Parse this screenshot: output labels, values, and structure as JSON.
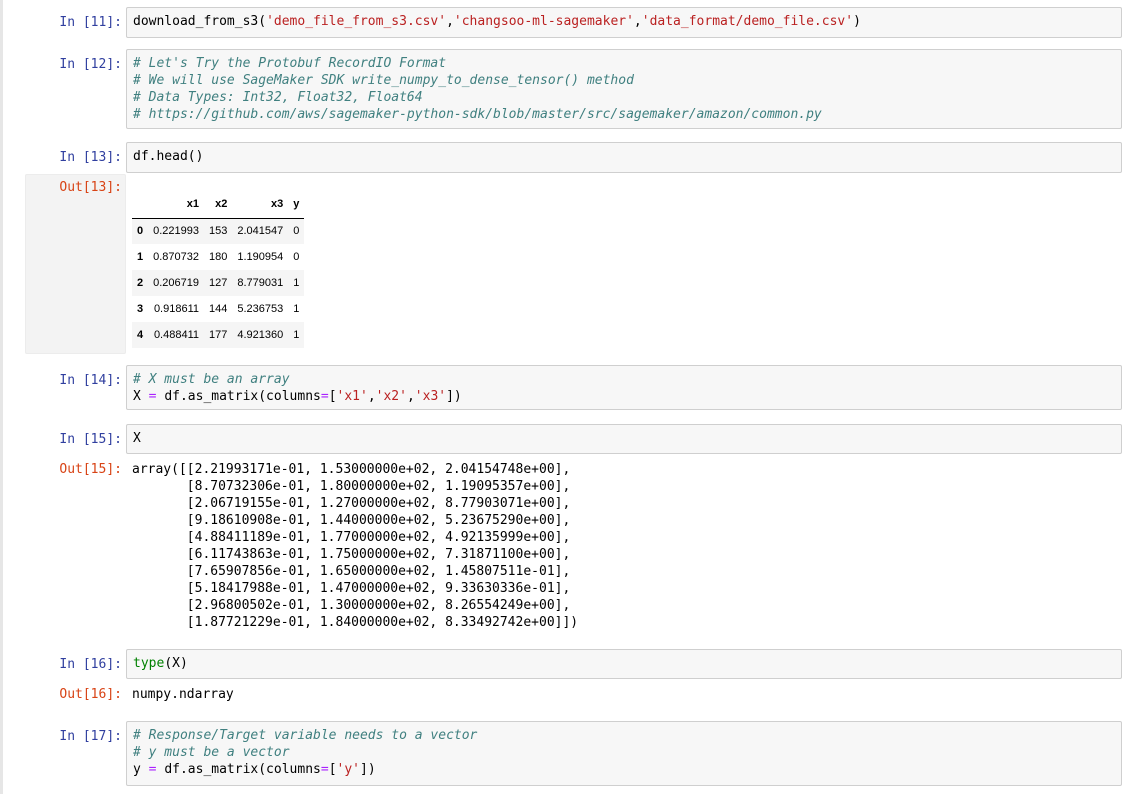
{
  "cells": {
    "c11": {
      "prompt": "In [11]:"
    },
    "c12": {
      "prompt": "In [12]:",
      "line1": "# Let's Try the Protobuf RecordIO Format",
      "line2": "# We will use SageMaker SDK write_numpy_to_dense_tensor() method",
      "line3": "# Data Types: Int32, Float32, Float64",
      "line4": "# https://github.com/aws/sagemaker-python-sdk/blob/master/src/sagemaker/amazon/common.py"
    },
    "c13": {
      "prompt": "In [13]:",
      "code": "df.head()",
      "out_prompt": "Out[13]:"
    },
    "c14": {
      "prompt": "In [14]:",
      "comment": "# X must be an array"
    },
    "c15": {
      "prompt": "In [15]:",
      "code": "X",
      "out_prompt": "Out[15]:",
      "output": "array([[2.21993171e-01, 1.53000000e+02, 2.04154748e+00],\n       [8.70732306e-01, 1.80000000e+02, 1.19095357e+00],\n       [2.06719155e-01, 1.27000000e+02, 8.77903071e+00],\n       [9.18610908e-01, 1.44000000e+02, 5.23675290e+00],\n       [4.88411189e-01, 1.77000000e+02, 4.92135999e+00],\n       [6.11743863e-01, 1.75000000e+02, 7.31871100e+00],\n       [7.65907856e-01, 1.65000000e+02, 1.45807511e-01],\n       [5.18417988e-01, 1.47000000e+02, 9.33630336e-01],\n       [2.96800502e-01, 1.30000000e+02, 8.26554249e+00],\n       [1.87721229e-01, 1.84000000e+02, 8.33492742e+00]])"
    },
    "c16": {
      "prompt": "In [16]:",
      "out_prompt": "Out[16]:",
      "output": "numpy.ndarray"
    },
    "c17": {
      "prompt": "In [17]:",
      "line1": "# Response/Target variable needs to a vector",
      "line2": "# y must be a vector"
    }
  },
  "dataframe": {
    "columns": [
      "",
      "x1",
      "x2",
      "x3",
      "y"
    ],
    "rows": [
      [
        "0",
        "0.221993",
        "153",
        "2.041547",
        "0"
      ],
      [
        "1",
        "0.870732",
        "180",
        "1.190954",
        "0"
      ],
      [
        "2",
        "0.206719",
        "127",
        "8.779031",
        "1"
      ],
      [
        "3",
        "0.918611",
        "144",
        "5.236753",
        "1"
      ],
      [
        "4",
        "0.488411",
        "177",
        "4.921360",
        "1"
      ]
    ]
  },
  "tokens": {
    "fn_download": "download_from_s3",
    "paren_open": "(",
    "paren_close": ")",
    "comma": ",",
    "s_file": "'demo_file_from_s3.csv'",
    "s_bucket": "'changsoo-ml-sagemaker'",
    "s_key": "'data_format/demo_file.csv'",
    "var_X": "X",
    "var_y": "y",
    "eq": "=",
    "as_matrix_open": "df.as_matrix(columns",
    "bracket_open": "[",
    "bracket_close": "])",
    "s_x1": "'x1'",
    "s_x2": "'x2'",
    "s_x3": "'x3'",
    "s_y": "'y'",
    "fn_type": "type",
    "arg_X": "(X)"
  }
}
